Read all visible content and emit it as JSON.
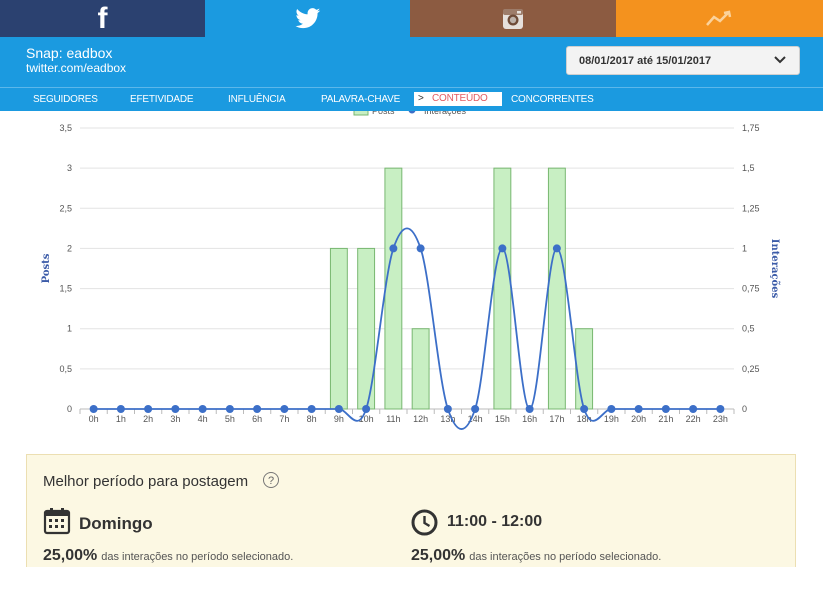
{
  "social_tabs": [
    {
      "name": "facebook",
      "label": "f",
      "icon": "facebook-icon"
    },
    {
      "name": "twitter",
      "icon": "twitter-bird-icon"
    },
    {
      "name": "instagram",
      "icon": "instagram-camera-icon"
    },
    {
      "name": "analytics",
      "icon": "trend-line-icon"
    }
  ],
  "header": {
    "snap_title": "Snap: eadbox",
    "snap_handle": "twitter.com/eadbox",
    "date_range": "08/01/2017 até 15/01/2017",
    "dropdown_icon": "chevron-down-icon"
  },
  "nav": {
    "items": [
      "SEGUIDORES",
      "EFETIVIDADE",
      "INFLUÊNCIA",
      "PALAVRA-CHAVE",
      "CONTEÚDO",
      "CONCORRENTES"
    ],
    "active": "CONTEÚDO",
    "active_marker": ">"
  },
  "colors": {
    "bar_fill": "#c8efc3",
    "bar_stroke": "#78b771",
    "line": "#3c6fc8",
    "accent_blue": "#1b9ae0",
    "active_tab_text": "#e35c62"
  },
  "chart_data": {
    "type": "bar",
    "legend": {
      "items": [
        "Posts",
        "Interações"
      ],
      "placement": "top-center"
    },
    "categories": [
      "0h",
      "1h",
      "2h",
      "3h",
      "4h",
      "5h",
      "6h",
      "7h",
      "8h",
      "9h",
      "10h",
      "11h",
      "12h",
      "13h",
      "14h",
      "15h",
      "16h",
      "17h",
      "18h",
      "19h",
      "20h",
      "21h",
      "22h",
      "23h"
    ],
    "series": [
      {
        "name": "Posts",
        "type": "bar",
        "axis": "left",
        "values": [
          0,
          0,
          0,
          0,
          0,
          0,
          0,
          0,
          0,
          2,
          2,
          3,
          1,
          0,
          0,
          3,
          0,
          3,
          1,
          0,
          0,
          0,
          0,
          0
        ]
      },
      {
        "name": "Interações",
        "type": "line",
        "axis": "right",
        "values": [
          0,
          0,
          0,
          0,
          0,
          0,
          0,
          0,
          0,
          0,
          0,
          1,
          1,
          0,
          0,
          1,
          0,
          1,
          0,
          0,
          0,
          0,
          0,
          0
        ]
      }
    ],
    "ylabel": "Posts",
    "y2label": "Interações",
    "ylim": [
      0,
      3.5
    ],
    "y2lim": [
      0,
      1.75
    ],
    "yticks": [
      "0",
      "0,5",
      "1",
      "1,5",
      "2",
      "2,5",
      "3",
      "3,5"
    ],
    "y2ticks": [
      "0",
      "0,25",
      "0,5",
      "0,75",
      "1",
      "1,25",
      "1,5",
      "1,75"
    ],
    "grid": true
  },
  "best_period": {
    "title": "Melhor período para postagem",
    "help_icon": "?",
    "day": "Domingo",
    "day_icon": "calendar-icon",
    "time": "11:00 - 12:00",
    "time_icon": "clock-icon",
    "day_percent": "25,00%",
    "time_percent": "25,00%",
    "stat_text": "das interações no período selecionado."
  }
}
